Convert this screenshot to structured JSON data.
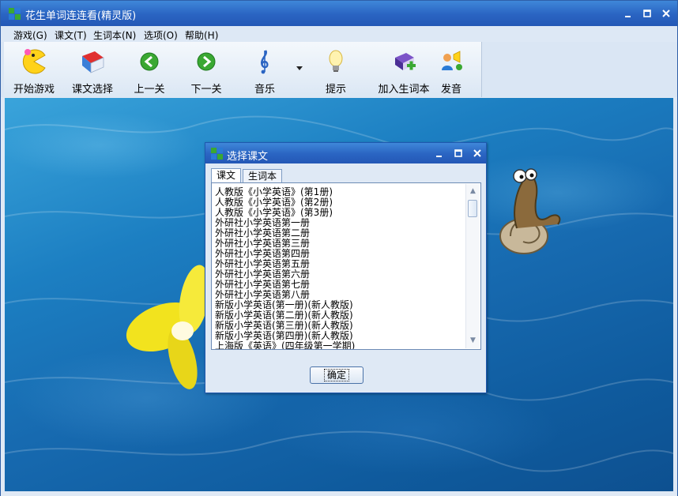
{
  "window": {
    "title": "花生单词连连看(精灵版)",
    "icon": "app-grid-icon",
    "controls": [
      "minimize",
      "maximize",
      "close"
    ]
  },
  "menu": {
    "items": [
      "游戏(G)",
      "课文(T)",
      "生词本(N)",
      "选项(O)",
      "帮助(H)"
    ]
  },
  "toolbar": {
    "buttons": [
      {
        "label": "开始游戏",
        "icon": "pacman-icon"
      },
      {
        "label": "课文选择",
        "icon": "book-icon"
      },
      {
        "label": "上一关",
        "icon": "arrow-left-icon"
      },
      {
        "label": "下一关",
        "icon": "arrow-right-icon"
      },
      {
        "label": "音乐",
        "icon": "music-note-icon"
      },
      {
        "label": "提示",
        "icon": "lightbulb-icon"
      },
      {
        "label": "加入生词本",
        "icon": "add-book-icon"
      },
      {
        "label": "发音",
        "icon": "speaker-person-icon"
      }
    ]
  },
  "dialog": {
    "title": "选择课文",
    "tabs": [
      "课文",
      "生词本"
    ],
    "active_tab": "课文",
    "items": [
      "人教版《小学英语》(第1册)",
      "人教版《小学英语》(第2册)",
      "人教版《小学英语》(第3册)",
      "外研社小学英语第一册",
      "外研社小学英语第二册",
      "外研社小学英语第三册",
      "外研社小学英语第四册",
      "外研社小学英语第五册",
      "外研社小学英语第六册",
      "外研社小学英语第七册",
      "外研社小学英语第八册",
      "新版小学英语(第一册)(新人教版)",
      "新版小学英语(第二册)(新人教版)",
      "新版小学英语(第三册)(新人教版)",
      "新版小学英语(第四册)(新人教版)",
      "上海版《英语》(四年级第一学期)"
    ],
    "ok_label": "确定"
  },
  "colors": {
    "titlebar": "#2a64c2",
    "menubar": "#dde8f5",
    "water": "#1c7fc2",
    "icon_green": "#3aa832",
    "icon_blue": "#2a7bd6"
  }
}
